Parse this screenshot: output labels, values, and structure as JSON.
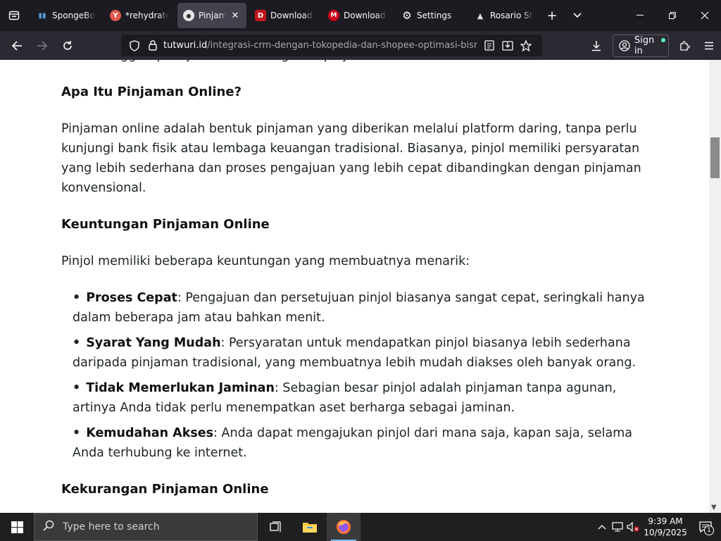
{
  "browser": {
    "tabs": [
      {
        "title": "SpongeBob",
        "favicon_color": "#2e6bb8",
        "favicon_glyph": "▮"
      },
      {
        "title": "*rehydrated",
        "favicon_color": "#e5574c",
        "favicon_glyph": "Y"
      },
      {
        "title": "Pinjaman",
        "favicon_color": "#e6e6e6",
        "favicon_glyph": "●",
        "active": true
      },
      {
        "title": "Download",
        "favicon_color": "#c4161c",
        "favicon_glyph": "D"
      },
      {
        "title": "Download",
        "favicon_color": "#d0021b",
        "favicon_glyph": "M"
      },
      {
        "title": "Settings",
        "favicon_color": "transparent",
        "favicon_glyph": "⚙"
      },
      {
        "title": "Rosario Stu",
        "favicon_color": "transparent",
        "favicon_glyph": "▲"
      }
    ],
    "url_domain": "tutwuri.id",
    "url_path": "/integrasi-crm-dengan-tokopedia-dan-shopee-optimasi-bisnis",
    "signin_label": "Sign in"
  },
  "article": {
    "cut_line": "dasar hingga tips bijak dalam mengelola pinjaman Anda.",
    "heading1": "Apa Itu Pinjaman Online?",
    "para1": "Pinjaman online adalah bentuk pinjaman yang diberikan melalui platform daring, tanpa perlu kunjungi bank fisik atau lembaga keuangan tradisional. Biasanya, pinjol memiliki persyaratan yang lebih sederhana dan proses pengajuan yang lebih cepat dibandingkan dengan pinjaman konvensional.",
    "heading2": "Keuntungan Pinjaman Online",
    "para2": "Pinjol memiliki beberapa keuntungan yang membuatnya menarik:",
    "bullets": [
      {
        "term": "Proses Cepat",
        "text": ": Pengajuan dan persetujuan pinjol biasanya sangat cepat, seringkali hanya dalam beberapa jam atau bahkan menit."
      },
      {
        "term": "Syarat Yang Mudah",
        "text": ": Persyaratan untuk mendapatkan pinjol biasanya lebih sederhana daripada pinjaman tradisional, yang membuatnya lebih mudah diakses oleh banyak orang."
      },
      {
        "term": "Tidak Memerlukan Jaminan",
        "text": ": Sebagian besar pinjol adalah pinjaman tanpa agunan, artinya Anda tidak perlu menempatkan aset berharga sebagai jaminan."
      },
      {
        "term": "Kemudahan Akses",
        "text": ": Anda dapat mengajukan pinjol dari mana saja, kapan saja, selama Anda terhubung ke internet."
      }
    ],
    "bullet_glyph": "•",
    "heading3": "Kekurangan Pinjaman Online"
  },
  "taskbar": {
    "search_placeholder": "Type here to search",
    "time": "9:39 AM",
    "date": "10/9/2025",
    "notification_count": "1"
  },
  "colors": {
    "tabstrip_bg": "#1c1b22",
    "navbar_bg": "#2b2a33",
    "active_tab_bg": "#42414d",
    "text": "#1d2327",
    "taskbar_bg": "#1f1f1f"
  }
}
